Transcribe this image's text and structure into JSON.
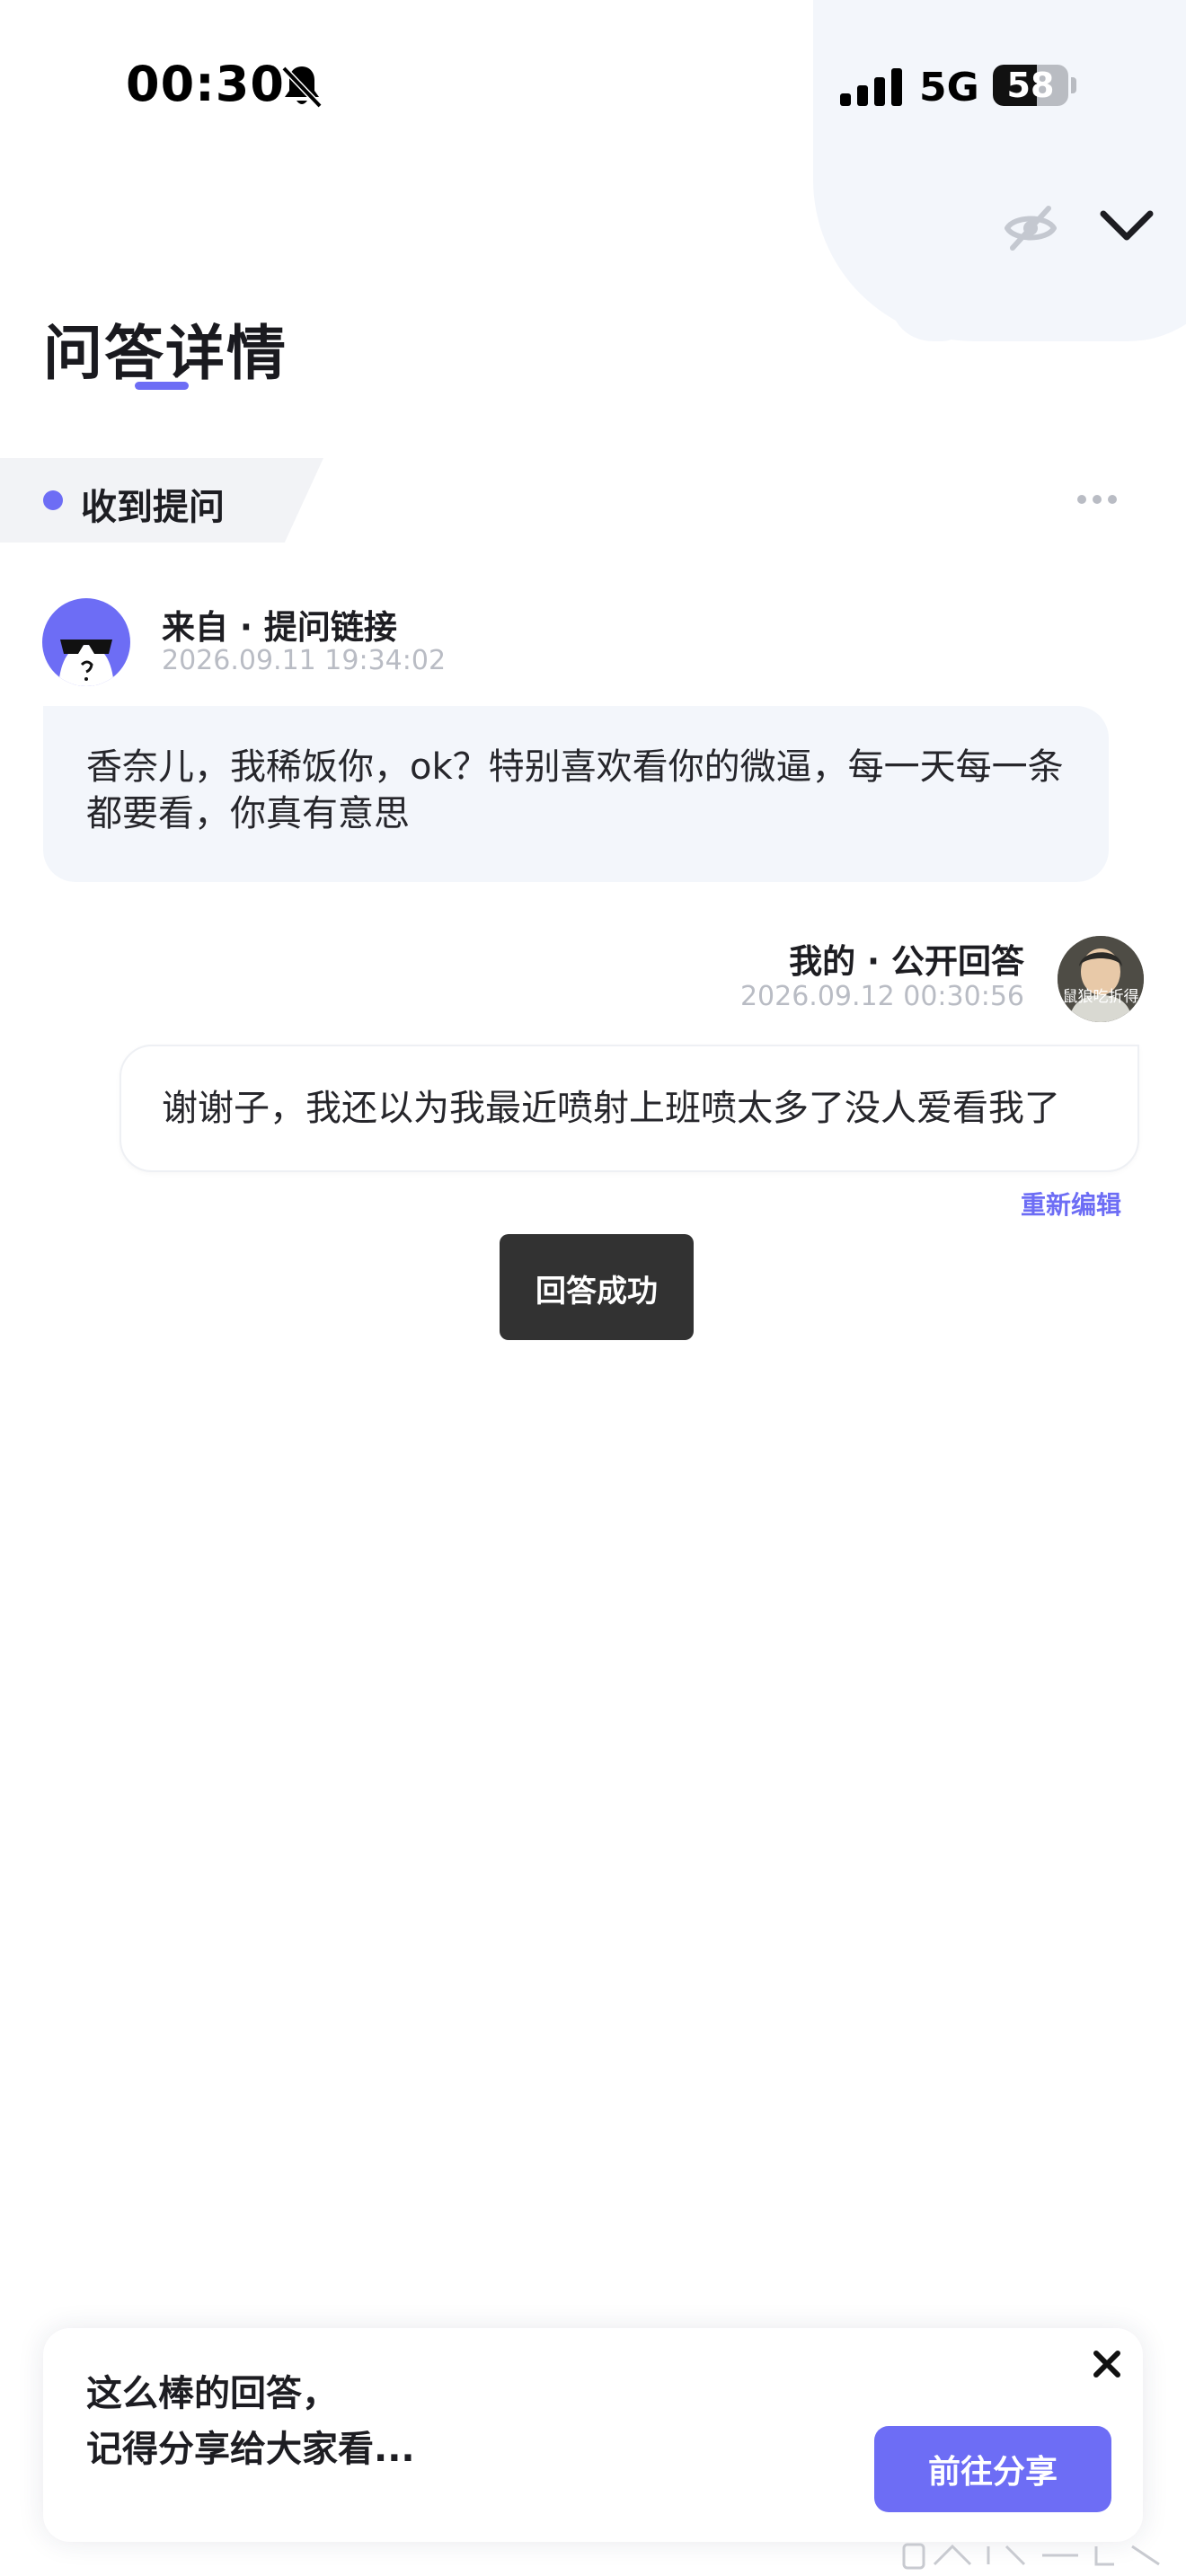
{
  "status_bar": {
    "time": "00:30",
    "network": "5G",
    "battery": "58",
    "battery_level": 0.58
  },
  "header": {
    "title": "问答详情",
    "hide_icon": "eye-off-icon",
    "collapse_icon": "chevron-down-icon"
  },
  "section": {
    "label": "收到提问",
    "more_icon": "more-dots-icon"
  },
  "question": {
    "source": "来自 · 提问链接",
    "time": "2026.09.11 19:34:02",
    "text": "香奈儿，我稀饭你，ok？特别喜欢看你的微逼，每一天每一条都要看，你真有意思"
  },
  "answer": {
    "source": "我的 · 公开回答",
    "time": "2026.09.12 00:30:56",
    "avatar_caption": "鼠狼吃折得",
    "text": "谢谢子，我还以为我最近喷射上班喷太多了没人爱看我了",
    "reedit_label": "重新编辑"
  },
  "toast": {
    "text": "回答成功"
  },
  "share_card": {
    "line1": "这么棒的回答，",
    "line2": "记得分享给大家看...",
    "button_label": "前往分享",
    "close_icon": "close-icon"
  },
  "colors": {
    "accent": "#6d6df5",
    "bubble_bg": "#f3f6fb",
    "toast_bg": "#323232",
    "muted_text": "#b9bcc4"
  }
}
